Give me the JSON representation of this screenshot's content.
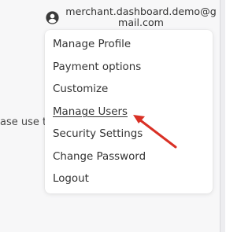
{
  "background": {
    "partial_text": "ase use t"
  },
  "account": {
    "email": "merchant.dashboard.demo@gmail.com",
    "icon": "user-circle-icon"
  },
  "menu": {
    "items": [
      {
        "label": "Manage Profile"
      },
      {
        "label": "Payment options"
      },
      {
        "label": "Customize"
      },
      {
        "label": "Manage Users",
        "highlighted": true
      },
      {
        "label": "Security Settings"
      },
      {
        "label": "Change Password"
      },
      {
        "label": "Logout"
      }
    ]
  },
  "annotation": {
    "icon": "red-arrow-icon",
    "color": "#d93025"
  },
  "colors": {
    "text": "#333333",
    "menu_bg": "#ffffff",
    "page_bg": "#f7f7f8"
  }
}
